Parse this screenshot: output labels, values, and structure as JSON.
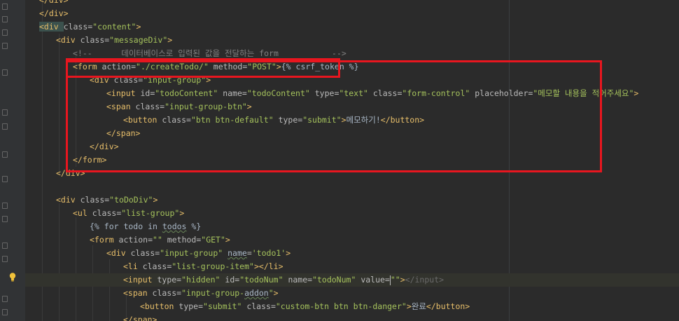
{
  "annotation_color": "#e8161f",
  "icons": {
    "gutter_hint": "lightbulb-icon"
  },
  "lines": [
    {
      "tokens": [
        [
          "t",
          "</div>"
        ]
      ]
    },
    {
      "tokens": [
        [
          "t",
          "</div>"
        ]
      ]
    },
    {
      "tokens": [
        [
          "t",
          "<div "
        ],
        [
          "a",
          "class="
        ],
        [
          "v",
          "\"content\""
        ],
        [
          "t",
          ">"
        ]
      ]
    },
    {
      "tokens": [
        [
          "t",
          "<div "
        ],
        [
          "a",
          "class="
        ],
        [
          "v",
          "\"messageDiv\""
        ],
        [
          "t",
          ">"
        ]
      ]
    },
    {
      "tokens": [
        [
          "c",
          "<!--      데이터베이스로 입력된 값을 전달하는 form           -->"
        ]
      ]
    },
    {
      "tokens": [
        [
          "t",
          "<form "
        ],
        [
          "a",
          "action="
        ],
        [
          "v",
          "\"./createTodo/\" "
        ],
        [
          "a",
          "method="
        ],
        [
          "v",
          "\"POST\""
        ],
        [
          "t",
          ">"
        ],
        [
          "x",
          "{% csrf_token %}"
        ]
      ]
    },
    {
      "tokens": [
        [
          "t",
          "<div "
        ],
        [
          "a",
          "class="
        ],
        [
          "v",
          "\"input-group\""
        ],
        [
          "t",
          ">"
        ]
      ]
    },
    {
      "tokens": [
        [
          "t",
          "<input "
        ],
        [
          "a",
          "id="
        ],
        [
          "v",
          "\"todoContent\" "
        ],
        [
          "a",
          "name="
        ],
        [
          "v",
          "\"todoContent\" "
        ],
        [
          "a",
          "type="
        ],
        [
          "v",
          "\"text\" "
        ],
        [
          "a",
          "class="
        ],
        [
          "v",
          "\"form-control\" "
        ],
        [
          "a",
          "placeholder="
        ],
        [
          "v",
          "\"메모할 내용을 적어주세요\""
        ],
        [
          "t",
          ">"
        ]
      ]
    },
    {
      "tokens": [
        [
          "t",
          "<span "
        ],
        [
          "a",
          "class="
        ],
        [
          "v",
          "\"input-group-btn\""
        ],
        [
          "t",
          ">"
        ]
      ]
    },
    {
      "tokens": [
        [
          "t",
          "<button "
        ],
        [
          "a",
          "class="
        ],
        [
          "v",
          "\"btn btn-default\" "
        ],
        [
          "a",
          "type="
        ],
        [
          "v",
          "\"submit\""
        ],
        [
          "t",
          ">"
        ],
        [
          "x",
          "메모하기!"
        ],
        [
          "t",
          "</button>"
        ]
      ]
    },
    {
      "tokens": [
        [
          "t",
          "</span>"
        ]
      ]
    },
    {
      "tokens": [
        [
          "t",
          "</div>"
        ]
      ]
    },
    {
      "tokens": [
        [
          "t",
          "</form>"
        ]
      ]
    },
    {
      "tokens": [
        [
          "t",
          "</div>"
        ]
      ]
    },
    {
      "tokens": []
    },
    {
      "tokens": [
        [
          "t",
          "<div "
        ],
        [
          "a",
          "class="
        ],
        [
          "v",
          "\"toDoDiv\""
        ],
        [
          "t",
          ">"
        ]
      ]
    },
    {
      "tokens": [
        [
          "t",
          "<ul "
        ],
        [
          "a",
          "class="
        ],
        [
          "v",
          "\"list-group\""
        ],
        [
          "t",
          ">"
        ]
      ]
    },
    {
      "tokens": [
        [
          "x",
          "{% for todo in "
        ],
        [
          "w",
          "todos"
        ],
        [
          "x",
          " %}"
        ]
      ]
    },
    {
      "tokens": [
        [
          "t",
          "<form "
        ],
        [
          "a",
          "action="
        ],
        [
          "v",
          "\"\" "
        ],
        [
          "a",
          "method="
        ],
        [
          "v",
          "\"GET\""
        ],
        [
          "t",
          ">"
        ]
      ]
    },
    {
      "tokens": [
        [
          "t",
          "<div "
        ],
        [
          "a",
          "class="
        ],
        [
          "v",
          "\"input-group\" "
        ],
        [
          "w",
          "name"
        ],
        [
          "a",
          "="
        ],
        [
          "v",
          "'todo1'"
        ],
        [
          "t",
          ">"
        ]
      ]
    },
    {
      "tokens": [
        [
          "t",
          "<li "
        ],
        [
          "a",
          "class="
        ],
        [
          "v",
          "\"list-group-item\""
        ],
        [
          "t",
          ">"
        ],
        [
          "t",
          "</li>"
        ]
      ]
    },
    {
      "tokens": [
        [
          "t",
          "<input "
        ],
        [
          "a",
          "type="
        ],
        [
          "v",
          "\"hidden\" "
        ],
        [
          "a",
          "id="
        ],
        [
          "v",
          "\"todoNum\" "
        ],
        [
          "a",
          "name="
        ],
        [
          "v",
          "\"todoNum\" "
        ],
        [
          "a",
          "value="
        ],
        [
          "v",
          "\"\""
        ],
        [
          "t",
          ">"
        ],
        [
          "d",
          "</input>"
        ]
      ]
    },
    {
      "tokens": [
        [
          "t",
          "<span "
        ],
        [
          "a",
          "class="
        ],
        [
          "v",
          "\"input-group-"
        ],
        [
          "w",
          "addon"
        ],
        [
          "v",
          "\""
        ],
        [
          "t",
          ">"
        ]
      ]
    },
    {
      "tokens": [
        [
          "t",
          "<button "
        ],
        [
          "a",
          "type="
        ],
        [
          "v",
          "\"submit\" "
        ],
        [
          "a",
          "class="
        ],
        [
          "v",
          "\"custom-btn btn btn-danger\""
        ],
        [
          "t",
          ">"
        ],
        [
          "x",
          "완료"
        ],
        [
          "t",
          "</button>"
        ]
      ]
    },
    {
      "tokens": [
        [
          "t",
          "</span>"
        ]
      ]
    }
  ]
}
